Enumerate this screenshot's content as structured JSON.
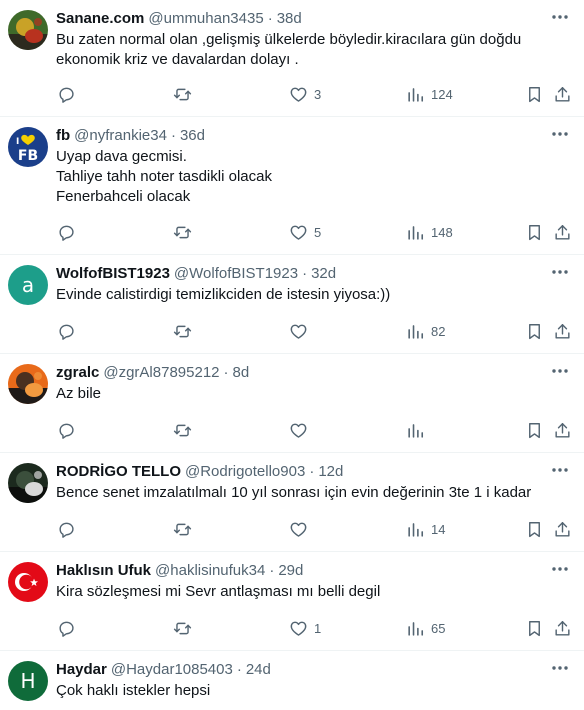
{
  "tweets": [
    {
      "name": "Sanane.com",
      "handle": "@ummuhan3435",
      "time": "38d",
      "lines": [
        "Bu zaten normal olan ,gelişmiş ülkelerde böyledir.kiracılara gün doğdu",
        "ekonomik kriz ve davalardan dolayı ."
      ],
      "reply_count": "",
      "retweet_count": "",
      "like_count": "3",
      "view_count": "124",
      "avatar": {
        "kind": "photo",
        "label": "portrait-photo",
        "colors": [
          "#3f6a2a",
          "#c9a227",
          "#b8321f",
          "#2c2a1e"
        ]
      }
    },
    {
      "name": "fb",
      "handle": "@nyfrankie34",
      "time": "36d",
      "lines": [
        "Uyap dava gecmisi.",
        "Tahliye tahh noter tasdikli olacak",
        "Fenerbahceli olacak"
      ],
      "reply_count": "",
      "retweet_count": "",
      "like_count": "5",
      "view_count": "148",
      "avatar": {
        "kind": "logo",
        "label": "fb-logo",
        "text": "FB",
        "colors": [
          "#1b3f8a",
          "#f5d000"
        ]
      }
    },
    {
      "name": "WolfofBIST1923",
      "handle": "@WolfofBIST1923",
      "time": "32d",
      "lines": [
        "Evinde calistirdigi temizlikciden de istesin yiyosa:))"
      ],
      "reply_count": "",
      "retweet_count": "",
      "like_count": "",
      "view_count": "82",
      "avatar": {
        "kind": "letter",
        "label": "letter-avatar",
        "letter": "a",
        "colors": [
          "#1d9e8a"
        ]
      }
    },
    {
      "name": "zgralc",
      "handle": "@zgrAl87895212",
      "time": "8d",
      "lines": [
        "Az bile"
      ],
      "reply_count": "",
      "retweet_count": "",
      "like_count": "",
      "view_count": "",
      "avatar": {
        "kind": "photo",
        "label": "group-photo",
        "colors": [
          "#e86a1a",
          "#4a3020",
          "#f29a40",
          "#1f1a18"
        ]
      }
    },
    {
      "name": "RODRİGO TELLO",
      "handle": "@Rodrigotello903",
      "time": "12d",
      "lines": [
        "Bence senet imzalatılmalı 10 yıl sonrası için evin değerinin 3te 1 i kadar"
      ],
      "reply_count": "",
      "retweet_count": "",
      "like_count": "",
      "view_count": "14",
      "avatar": {
        "kind": "photo",
        "label": "player-photo",
        "colors": [
          "#1c2a1e",
          "#3b4f3c",
          "#d8d8d8",
          "#0d0f0d"
        ]
      }
    },
    {
      "name": "Haklısın Ufuk",
      "handle": "@haklisinufuk34",
      "time": "29d",
      "lines": [
        "Kira sözleşmesi mi  Sevr antlaşması mı belli degil"
      ],
      "reply_count": "",
      "retweet_count": "",
      "like_count": "1",
      "view_count": "65",
      "avatar": {
        "kind": "flag",
        "label": "turkish-flag",
        "colors": [
          "#e30a17",
          "#ffffff"
        ]
      }
    },
    {
      "name": "Haydar",
      "handle": "@Haydar1085403",
      "time": "24d",
      "lines": [
        "Çok haklı istekler hepsi"
      ],
      "reply_count": "",
      "retweet_count": "",
      "like_count": "",
      "view_count": "",
      "avatar": {
        "kind": "letter",
        "label": "letter-avatar",
        "letter": "H",
        "colors": [
          "#0f6b3a"
        ]
      }
    }
  ],
  "icons": {
    "reply": "reply-icon",
    "retweet": "retweet-icon",
    "like": "like-icon",
    "views": "views-icon",
    "bookmark": "bookmark-icon",
    "share": "share-icon",
    "more": "more-icon"
  },
  "colors": {
    "text": "#0f1419",
    "secondary": "#536471",
    "divider": "#eff3f4"
  }
}
